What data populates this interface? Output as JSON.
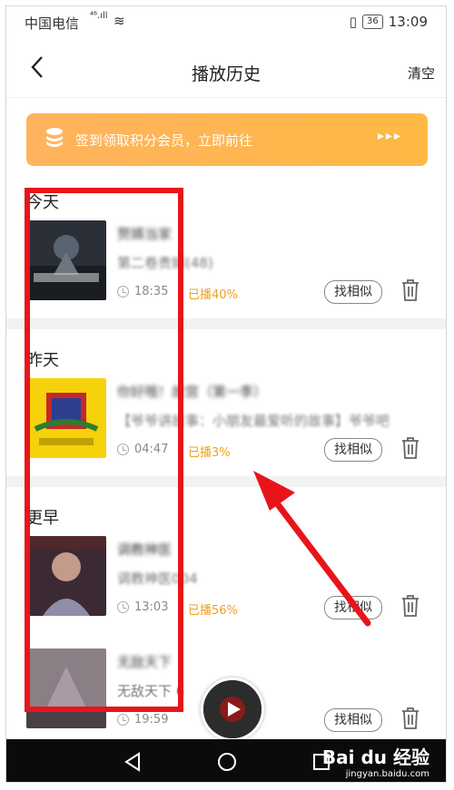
{
  "status_bar": {
    "carrier": "中国电信",
    "signal": "⁴⁶.ıll",
    "battery": "36",
    "time": "13:09"
  },
  "header": {
    "back_icon": "chevron-left-icon",
    "title": "播放历史",
    "clear": "清空"
  },
  "banner": {
    "text": "签到领取积分会员，立即前往",
    "arrows": "▸▸▸",
    "icon": "coin-stack-icon"
  },
  "sections": {
    "today": "今天",
    "yesterday": "昨天",
    "earlier": "更早"
  },
  "items": [
    {
      "name": "赘婿当家",
      "sub_blur": "第二卷贵婿(",
      "sub_clear": "48)",
      "time": "18:35",
      "played": "已播40%",
      "similar": "找相似"
    },
    {
      "name": "你好哦！故宫（第一季）",
      "sub_blur": "【爷爷讲故事：小朋友最爱听的故事】",
      "sub_clear": "爷爷吧",
      "time": "04:47",
      "played": "已播3%",
      "similar": "找相似"
    },
    {
      "name": "调教神医",
      "sub_blur": "调教神医",
      "sub_clear": "004",
      "time": "13:03",
      "played": "已播56%",
      "similar": "找相似"
    },
    {
      "name": "无敌天下",
      "sub_blur": "",
      "sub_clear": "无敌天下 6",
      "time": "19:59",
      "played": "",
      "similar": "找相似"
    }
  ],
  "watermark": {
    "brand": "Bai du 经验",
    "url": "jingyan.baidu.com"
  },
  "colors": {
    "accent_orange": "#f0a020",
    "annotation_red": "#e8141a"
  }
}
